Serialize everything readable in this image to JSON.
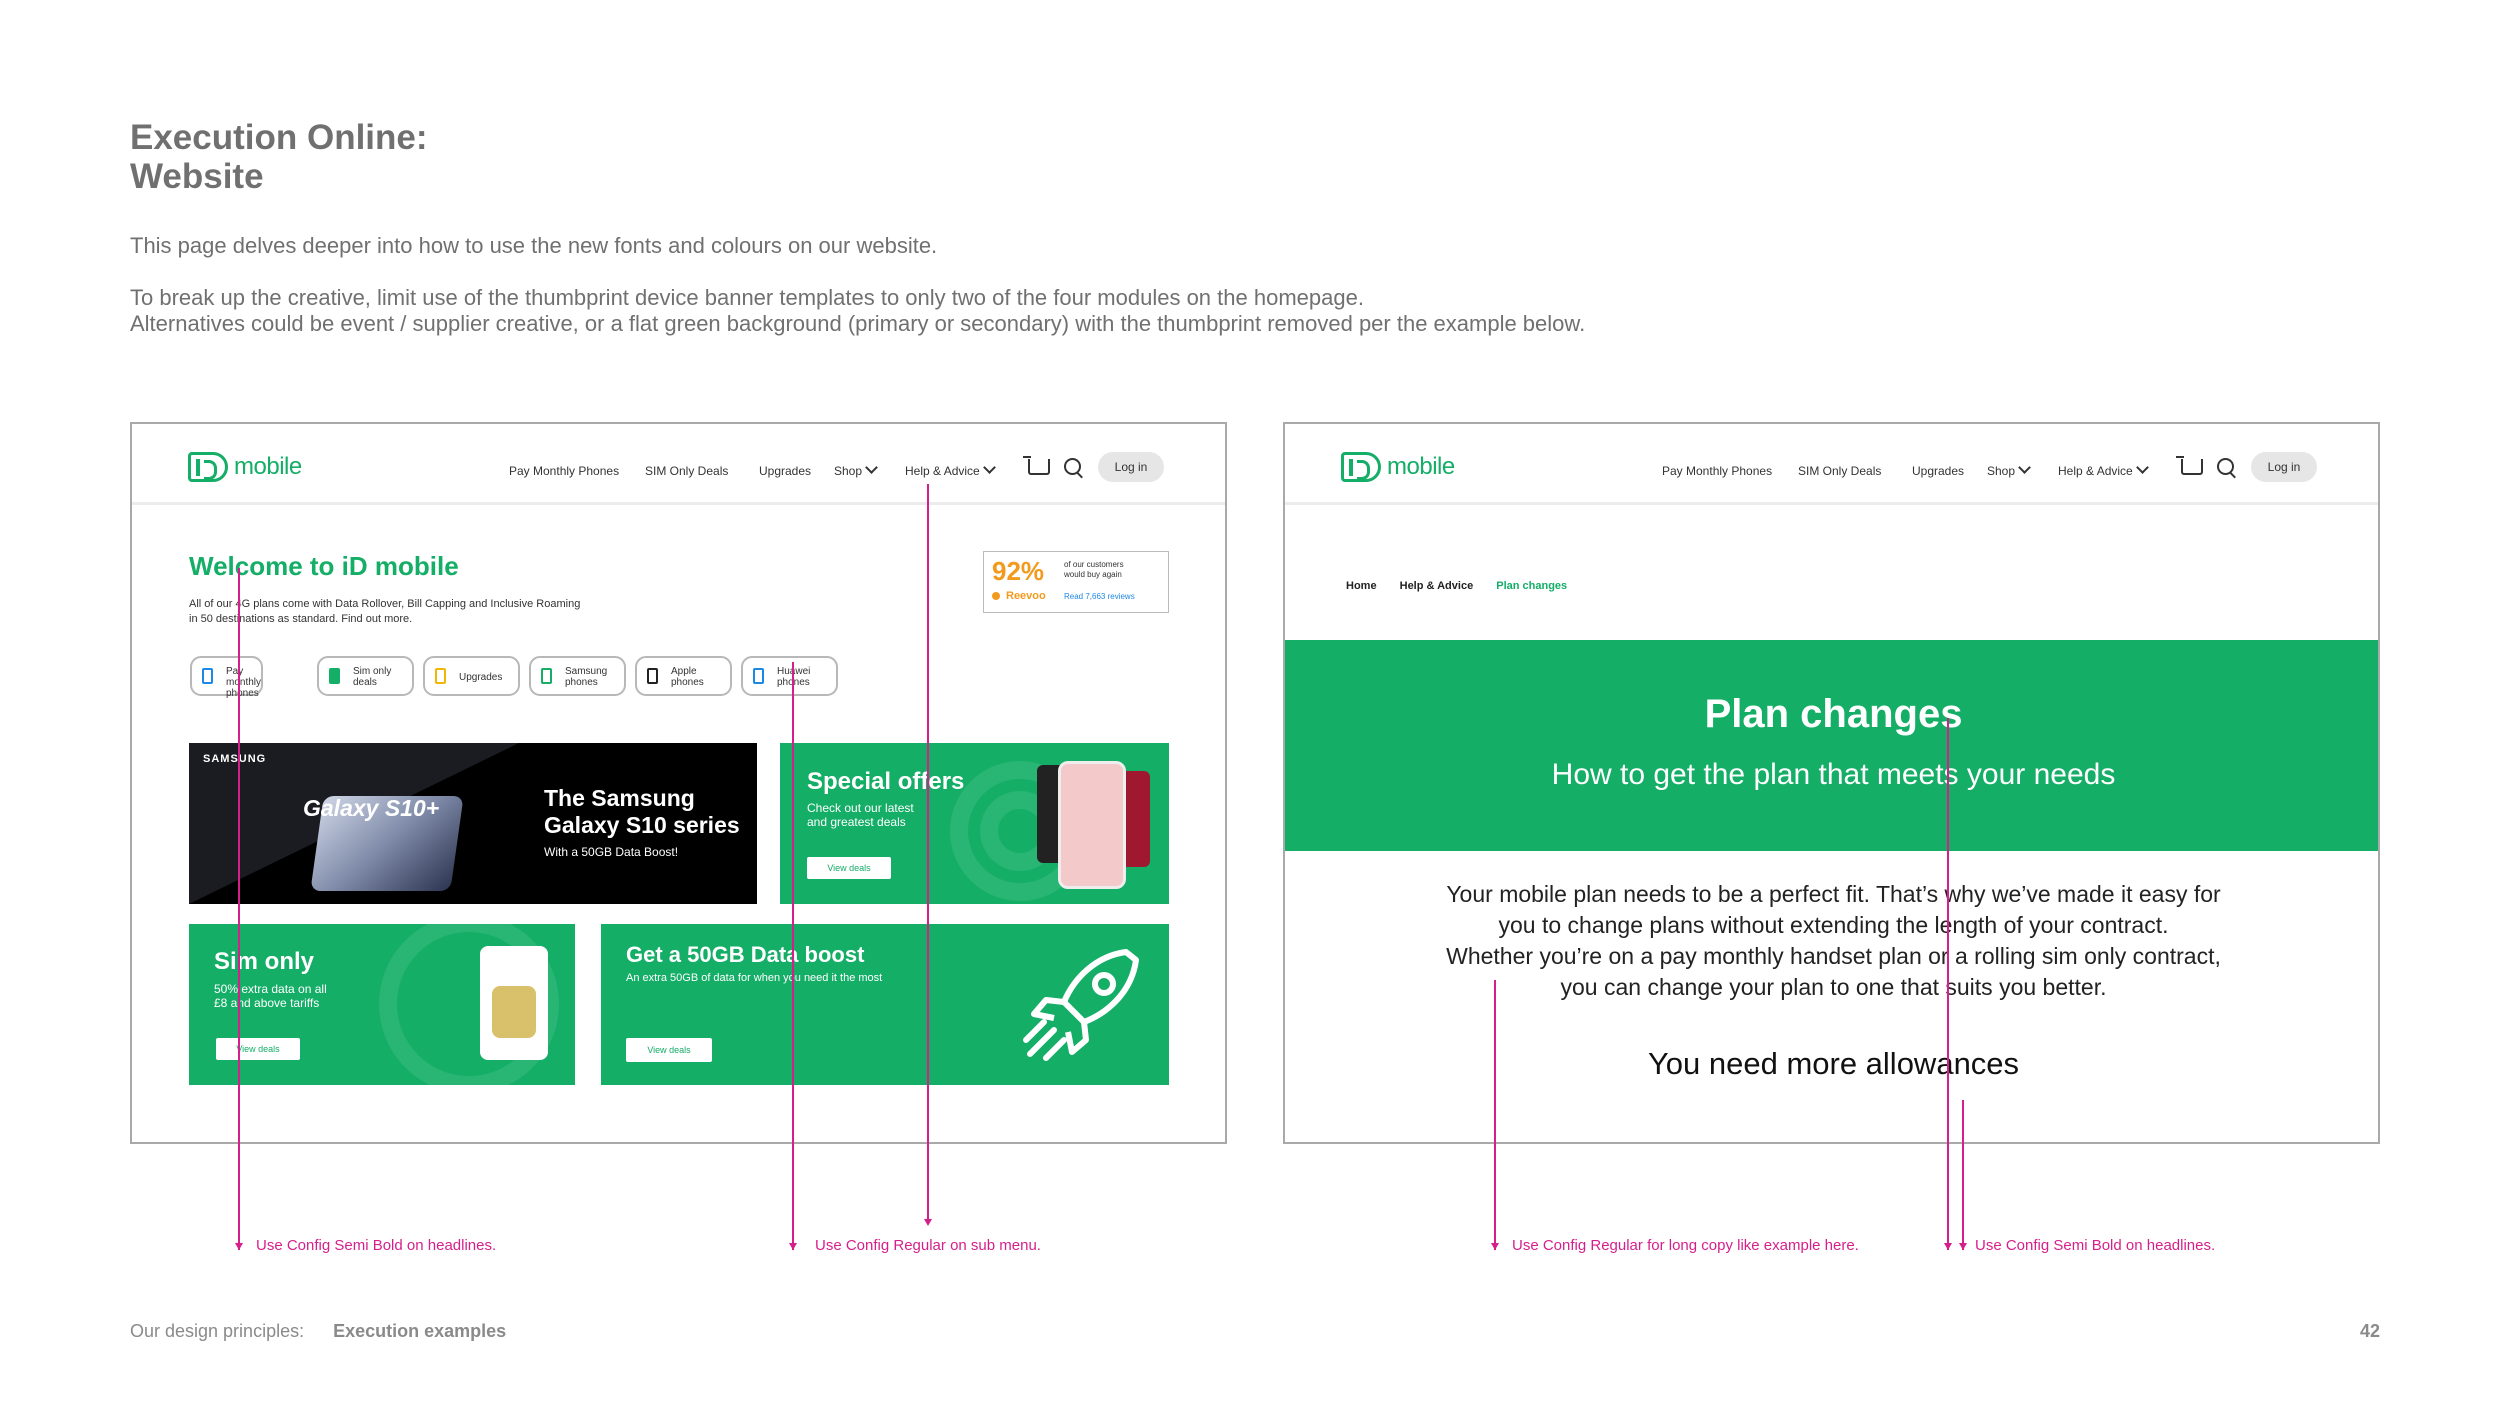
{
  "page": {
    "title_line1": "Execution Online:",
    "title_line2": "Website",
    "intro1": "This page delves deeper into how to use the new fonts and colours on our website.",
    "intro2": "To break up the creative, limit use of the thumbprint device banner templates to only two of the four modules on the homepage.",
    "intro3": "Alternatives could be event / supplier creative, or a flat green background (primary or secondary) with the thumbprint removed per the example below."
  },
  "nav": {
    "logo_text": "mobile",
    "links": [
      "Pay Monthly Phones",
      "SIM Only Deals",
      "Upgrades",
      "Shop",
      "Help & Advice"
    ],
    "login": "Log in"
  },
  "left": {
    "welcome": "Welcome to iD mobile",
    "desc_line1": "All of our 4G plans come with Data Rollover, Bill Capping and Inclusive Roaming",
    "desc_line2": "in 50 destinations as standard. Find out more.",
    "reevoo": {
      "percent": "92%",
      "text_line1": "of our customers",
      "text_line2": "would buy again",
      "brand": "Reevoo",
      "reviews": "Read 7,663 reviews"
    },
    "chips": [
      {
        "line1": "Pay monthly",
        "line2": "phones",
        "color": "#1e88e5"
      },
      {
        "line1": "Sim only",
        "line2": "deals",
        "color": "#14ae67"
      },
      {
        "line1": "Upgrades",
        "line2": "",
        "color": "#f2b705"
      },
      {
        "line1": "Samsung",
        "line2": "phones",
        "color": "#14ae67"
      },
      {
        "line1": "Apple",
        "line2": "phones",
        "color": "#222222"
      },
      {
        "line1": "Huawei",
        "line2": "phones",
        "color": "#1e88e5"
      }
    ],
    "samsung": {
      "brand": "SAMSUNG",
      "product": "Galaxy S10+",
      "headline1": "The Samsung",
      "headline2": "Galaxy S10 series",
      "sub": "With a 50GB Data Boost!"
    },
    "special": {
      "title": "Special offers",
      "sub1": "Check out our latest",
      "sub2": "and greatest deals",
      "button": "View deals"
    },
    "simonly": {
      "title": "Sim only",
      "sub1": "50% extra data on all",
      "sub2": "£8 and above tariffs",
      "button": "View deals"
    },
    "boost": {
      "title": "Get a 50GB Data boost",
      "sub": "An extra 50GB of data for when you need it the most",
      "button": "View deals"
    }
  },
  "right": {
    "breadcrumb": [
      "Home",
      "Help & Advice",
      "Plan changes"
    ],
    "hero_title": "Plan changes",
    "hero_sub": "How to get the plan that meets your needs",
    "body_lines": [
      "Your mobile plan needs to be a perfect fit. That’s why we’ve made it easy for",
      "you to change plans without extending the length of your contract.",
      "Whether you’re on a pay monthly handset plan or a rolling sim only contract,",
      "you can change your plan to one that suits you better."
    ],
    "subhead": "You need more allowances"
  },
  "annotations": [
    "Use Config Semi Bold on headlines.",
    "Use Config Regular on sub menu.",
    "Use Config Regular for long copy like example here.",
    "Use Config Semi Bold on headlines."
  ],
  "footer": {
    "section": "Our design principles:",
    "subsection": "Execution examples",
    "page_number": "42"
  },
  "colors": {
    "brand_green": "#14ae67",
    "annotation_pink": "#d61f8b",
    "reevoo_orange": "#f29a1d"
  }
}
